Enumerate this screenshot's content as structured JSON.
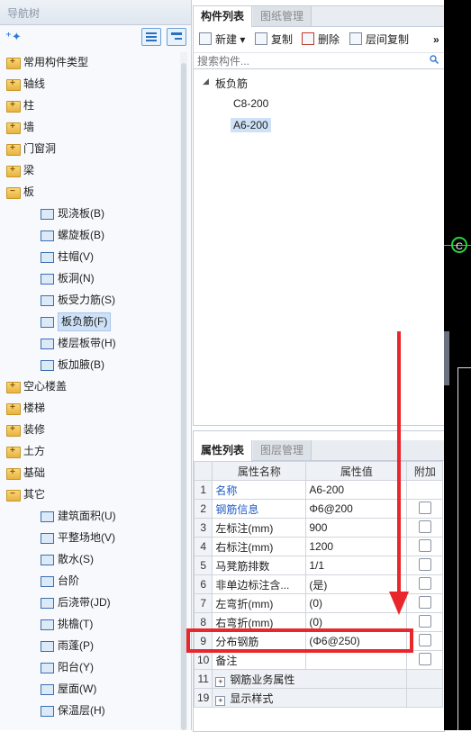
{
  "nav": {
    "title": "导航树",
    "tree": [
      {
        "label": "常用构件类型",
        "type": "folder"
      },
      {
        "label": "轴线",
        "type": "folder"
      },
      {
        "label": "柱",
        "type": "folder"
      },
      {
        "label": "墙",
        "type": "folder"
      },
      {
        "label": "门窗洞",
        "type": "folder"
      },
      {
        "label": "梁",
        "type": "folder"
      },
      {
        "label": "板",
        "type": "folder-open"
      },
      {
        "label": "现浇板(B)",
        "type": "item"
      },
      {
        "label": "螺旋板(B)",
        "type": "item"
      },
      {
        "label": "柱帽(V)",
        "type": "item"
      },
      {
        "label": "板洞(N)",
        "type": "item"
      },
      {
        "label": "板受力筋(S)",
        "type": "item"
      },
      {
        "label": "板负筋(F)",
        "type": "item",
        "selected": true
      },
      {
        "label": "楼层板带(H)",
        "type": "item"
      },
      {
        "label": "板加腋(B)",
        "type": "item"
      },
      {
        "label": "空心楼盖",
        "type": "folder"
      },
      {
        "label": "楼梯",
        "type": "folder"
      },
      {
        "label": "装修",
        "type": "folder"
      },
      {
        "label": "土方",
        "type": "folder"
      },
      {
        "label": "基础",
        "type": "folder"
      },
      {
        "label": "其它",
        "type": "folder-open"
      },
      {
        "label": "建筑面积(U)",
        "type": "item"
      },
      {
        "label": "平整场地(V)",
        "type": "item"
      },
      {
        "label": "散水(S)",
        "type": "item"
      },
      {
        "label": "台阶",
        "type": "item"
      },
      {
        "label": "后浇带(JD)",
        "type": "item"
      },
      {
        "label": "挑檐(T)",
        "type": "item"
      },
      {
        "label": "雨蓬(P)",
        "type": "item"
      },
      {
        "label": "阳台(Y)",
        "type": "item"
      },
      {
        "label": "屋面(W)",
        "type": "item"
      },
      {
        "label": "保温层(H)",
        "type": "item"
      }
    ]
  },
  "component_panel": {
    "tabs": [
      "构件列表",
      "图纸管理"
    ],
    "toolbar": {
      "new": "新建",
      "copy": "复制",
      "delete": "删除",
      "floor_copy": "层间复制",
      "more": "»"
    },
    "search_placeholder": "搜索构件...",
    "tree_root": "板负筋",
    "items": [
      "C8-200",
      "A6-200"
    ],
    "selected_item": "A6-200"
  },
  "property_panel": {
    "tabs": [
      "属性列表",
      "图层管理"
    ],
    "headers": {
      "name": "属性名称",
      "value": "属性值",
      "extra": "附加"
    },
    "rows": [
      {
        "num": "1",
        "name": "名称",
        "value": "A6-200",
        "blue": true,
        "checkbox": false
      },
      {
        "num": "2",
        "name": "钢筋信息",
        "value": "Φ6@200",
        "blue": true,
        "checkbox": true
      },
      {
        "num": "3",
        "name": "左标注(mm)",
        "value": "900",
        "blue": false,
        "checkbox": true
      },
      {
        "num": "4",
        "name": "右标注(mm)",
        "value": "1200",
        "blue": false,
        "checkbox": true
      },
      {
        "num": "5",
        "name": "马凳筋排数",
        "value": "1/1",
        "blue": false,
        "checkbox": true
      },
      {
        "num": "6",
        "name": "非单边标注含...",
        "value": "(是)",
        "blue": false,
        "checkbox": true
      },
      {
        "num": "7",
        "name": "左弯折(mm)",
        "value": "(0)",
        "blue": false,
        "checkbox": true
      },
      {
        "num": "8",
        "name": "右弯折(mm)",
        "value": "(0)",
        "blue": false,
        "checkbox": true
      },
      {
        "num": "9",
        "name": "分布钢筋",
        "value": "(Φ6@250)",
        "blue": false,
        "checkbox": true
      },
      {
        "num": "10",
        "name": "备注",
        "value": "",
        "blue": false,
        "checkbox": true
      }
    ],
    "groups": [
      {
        "num": "11",
        "name": "钢筋业务属性"
      },
      {
        "num": "19",
        "name": "显示样式"
      }
    ]
  },
  "canvas": {
    "snap_marker": "C"
  },
  "colors": {
    "highlight": "#e8262b",
    "link_blue": "#1e5cc8",
    "selection": "#cfe1f7"
  }
}
